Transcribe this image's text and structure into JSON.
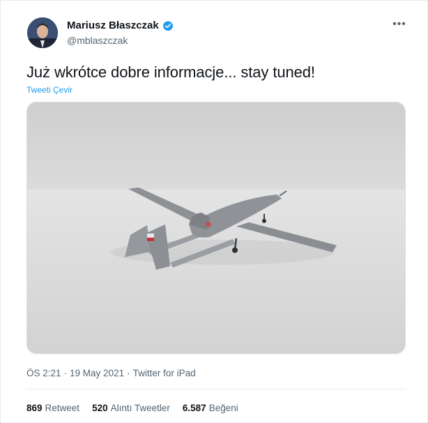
{
  "user": {
    "display_name": "Mariusz Błaszczak",
    "handle": "@mblaszczak",
    "verified": true,
    "avatar_icon": "profile-photo"
  },
  "more_icon": "more-horizontal-icon",
  "tweet": {
    "text": "Już wkrótce dobre informacje... stay tuned!",
    "translate_label": "Tweeti Çevir",
    "media_icon": "drone-photo"
  },
  "meta": {
    "time": "ÖS 2:21",
    "sep1": "·",
    "date": "19 May 2021",
    "sep2": "·",
    "source": "Twitter for iPad"
  },
  "stats": [
    {
      "count": "869",
      "label": "Retweet"
    },
    {
      "count": "520",
      "label": "Alıntı Tweetler"
    },
    {
      "count": "6.587",
      "label": "Beğeni"
    }
  ],
  "colors": {
    "link": "#1d9bf0",
    "muted": "#536471",
    "verified": "#1d9bf0"
  }
}
